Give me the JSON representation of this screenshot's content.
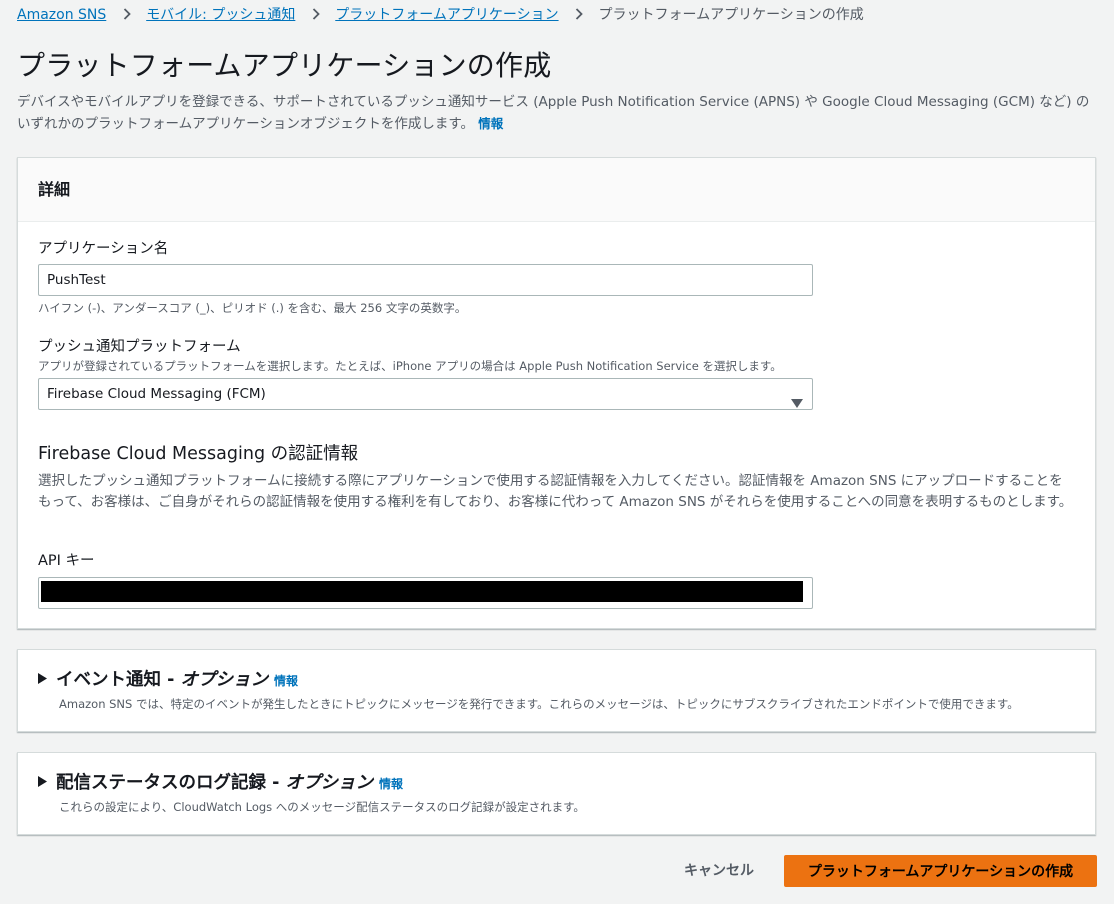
{
  "breadcrumb": {
    "items": [
      "Amazon SNS",
      "モバイル: プッシュ通知",
      "プラットフォームアプリケーション"
    ],
    "current": "プラットフォームアプリケーションの作成"
  },
  "page": {
    "title": "プラットフォームアプリケーションの作成",
    "description": "デバイスやモバイルアプリを登録できる、サポートされているプッシュ通知サービス (Apple Push Notification Service (APNS) や Google Cloud Messaging (GCM) など) のいずれかのプラットフォームアプリケーションオブジェクトを作成します。",
    "info_link": "情報"
  },
  "details": {
    "header": "詳細",
    "app_name": {
      "label": "アプリケーション名",
      "value": "PushTest",
      "hint": "ハイフン (-)、アンダースコア (_)、ピリオド (.) を含む、最大 256 文字の英数字。"
    },
    "platform": {
      "label": "プッシュ通知プラットフォーム",
      "hint": "アプリが登録されているプラットフォームを選択します。たとえば、iPhone アプリの場合は Apple Push Notification Service を選択します。",
      "selected": "Firebase Cloud Messaging (FCM)"
    },
    "credentials": {
      "heading": "Firebase Cloud Messaging の認証情報",
      "description": "選択したプッシュ通知プラットフォームに接続する際にアプリケーションで使用する認証情報を入力してください。認証情報を Amazon SNS にアップロードすることをもって、お客様は、ご自身がそれらの認証情報を使用する権利を有しており、お客様に代わって Amazon SNS がそれらを使用することへの同意を表明するものとします。",
      "api_key_label": "API キー"
    }
  },
  "event_notifications": {
    "title": "イベント通知 - ",
    "optional": "オプション",
    "info_link": "情報",
    "description": "Amazon SNS では、特定のイベントが発生したときにトピックにメッセージを発行できます。これらのメッセージは、トピックにサブスクライブされたエンドポイントで使用できます。"
  },
  "delivery_logging": {
    "title": "配信ステータスのログ記録 - ",
    "optional": "オプション",
    "info_link": "情報",
    "description": "これらの設定により、CloudWatch Logs へのメッセージ配信ステータスのログ記録が設定されます。"
  },
  "actions": {
    "cancel": "キャンセル",
    "create": "プラットフォームアプリケーションの作成"
  },
  "colors": {
    "link": "#0073bb",
    "primary_button": "#ec7211",
    "background": "#f2f3f3"
  }
}
